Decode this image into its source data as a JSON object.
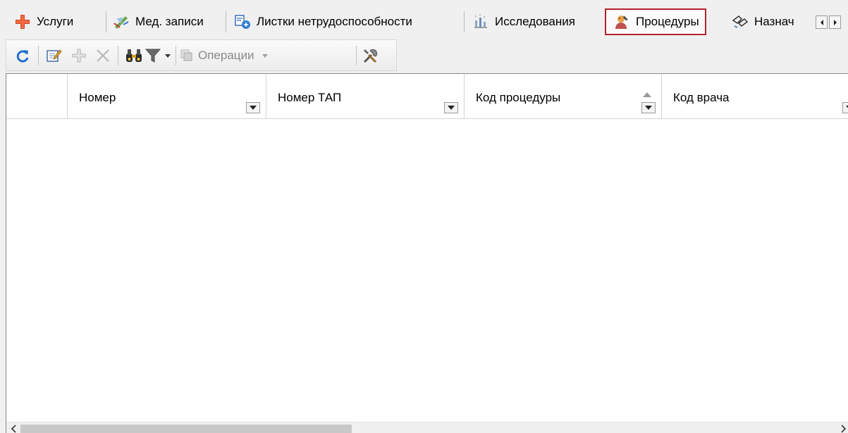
{
  "tabs": [
    {
      "label": "Услуги",
      "icon": "medical-cross-icon"
    },
    {
      "label": "Мед. записи",
      "icon": "medical-record-icon"
    },
    {
      "label": "Листки нетрудоспособности",
      "icon": "sick-leave-icon"
    },
    {
      "label": "Исследования",
      "icon": "research-icon"
    },
    {
      "label": "Процедуры",
      "icon": "procedure-icon",
      "active": true
    },
    {
      "label": "Назнач",
      "icon": "prescription-icon"
    }
  ],
  "toolbar": {
    "operations_label": "Операции"
  },
  "grid": {
    "columns": [
      {
        "label": "Номер"
      },
      {
        "label": "Номер ТАП"
      },
      {
        "label": "Код процедуры",
        "sorted": "asc"
      },
      {
        "label": "Код врача"
      }
    ],
    "rows": []
  },
  "colors": {
    "active_tab_border": "#b3232b",
    "background": "#f0f0f0"
  }
}
